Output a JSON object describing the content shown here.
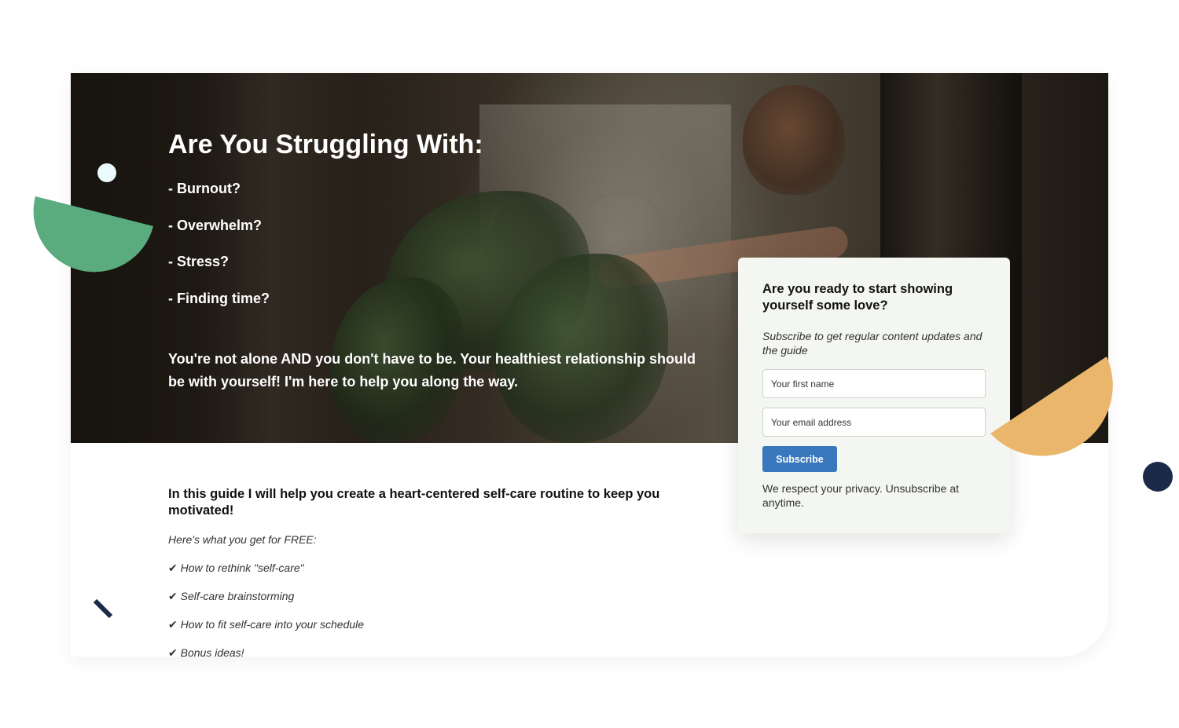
{
  "hero": {
    "title": "Are You Struggling With:",
    "items": [
      "- Burnout?",
      "- Overwhelm?",
      "- Stress?",
      "- Finding time?"
    ],
    "tagline": "You're not alone AND you don't have to be. Your healthiest relationship should be with yourself! I'm here to help you along the way."
  },
  "guide": {
    "heading": "In this guide I will help you create a heart-centered self-care routine to keep you motivated!",
    "intro": "Here's what you get for FREE:",
    "benefits": [
      "✔ How to rethink \"self-care\"",
      "✔ Self-care brainstorming",
      "✔ How to fit self-care into your schedule",
      "✔ Bonus ideas!"
    ]
  },
  "form": {
    "title": "Are you ready to start showing yourself some love?",
    "subtitle": "Subscribe to get regular content updates and the guide",
    "first_name_placeholder": "Your first name",
    "email_placeholder": "Your email address",
    "subscribe_label": "Subscribe",
    "privacy": "We respect your privacy. Unsubscribe at anytime."
  },
  "colors": {
    "accent_button": "#3a78bd",
    "green_shape": "#5aab7e",
    "orange_shape": "#eab66c",
    "navy": "#1c2a4a",
    "light_circle": "#eafbfd",
    "form_background": "#f3f6f1"
  },
  "decorations": [
    "light-circle",
    "green-semicircle",
    "orange-semicircle",
    "navy-circle",
    "navy-dash"
  ]
}
